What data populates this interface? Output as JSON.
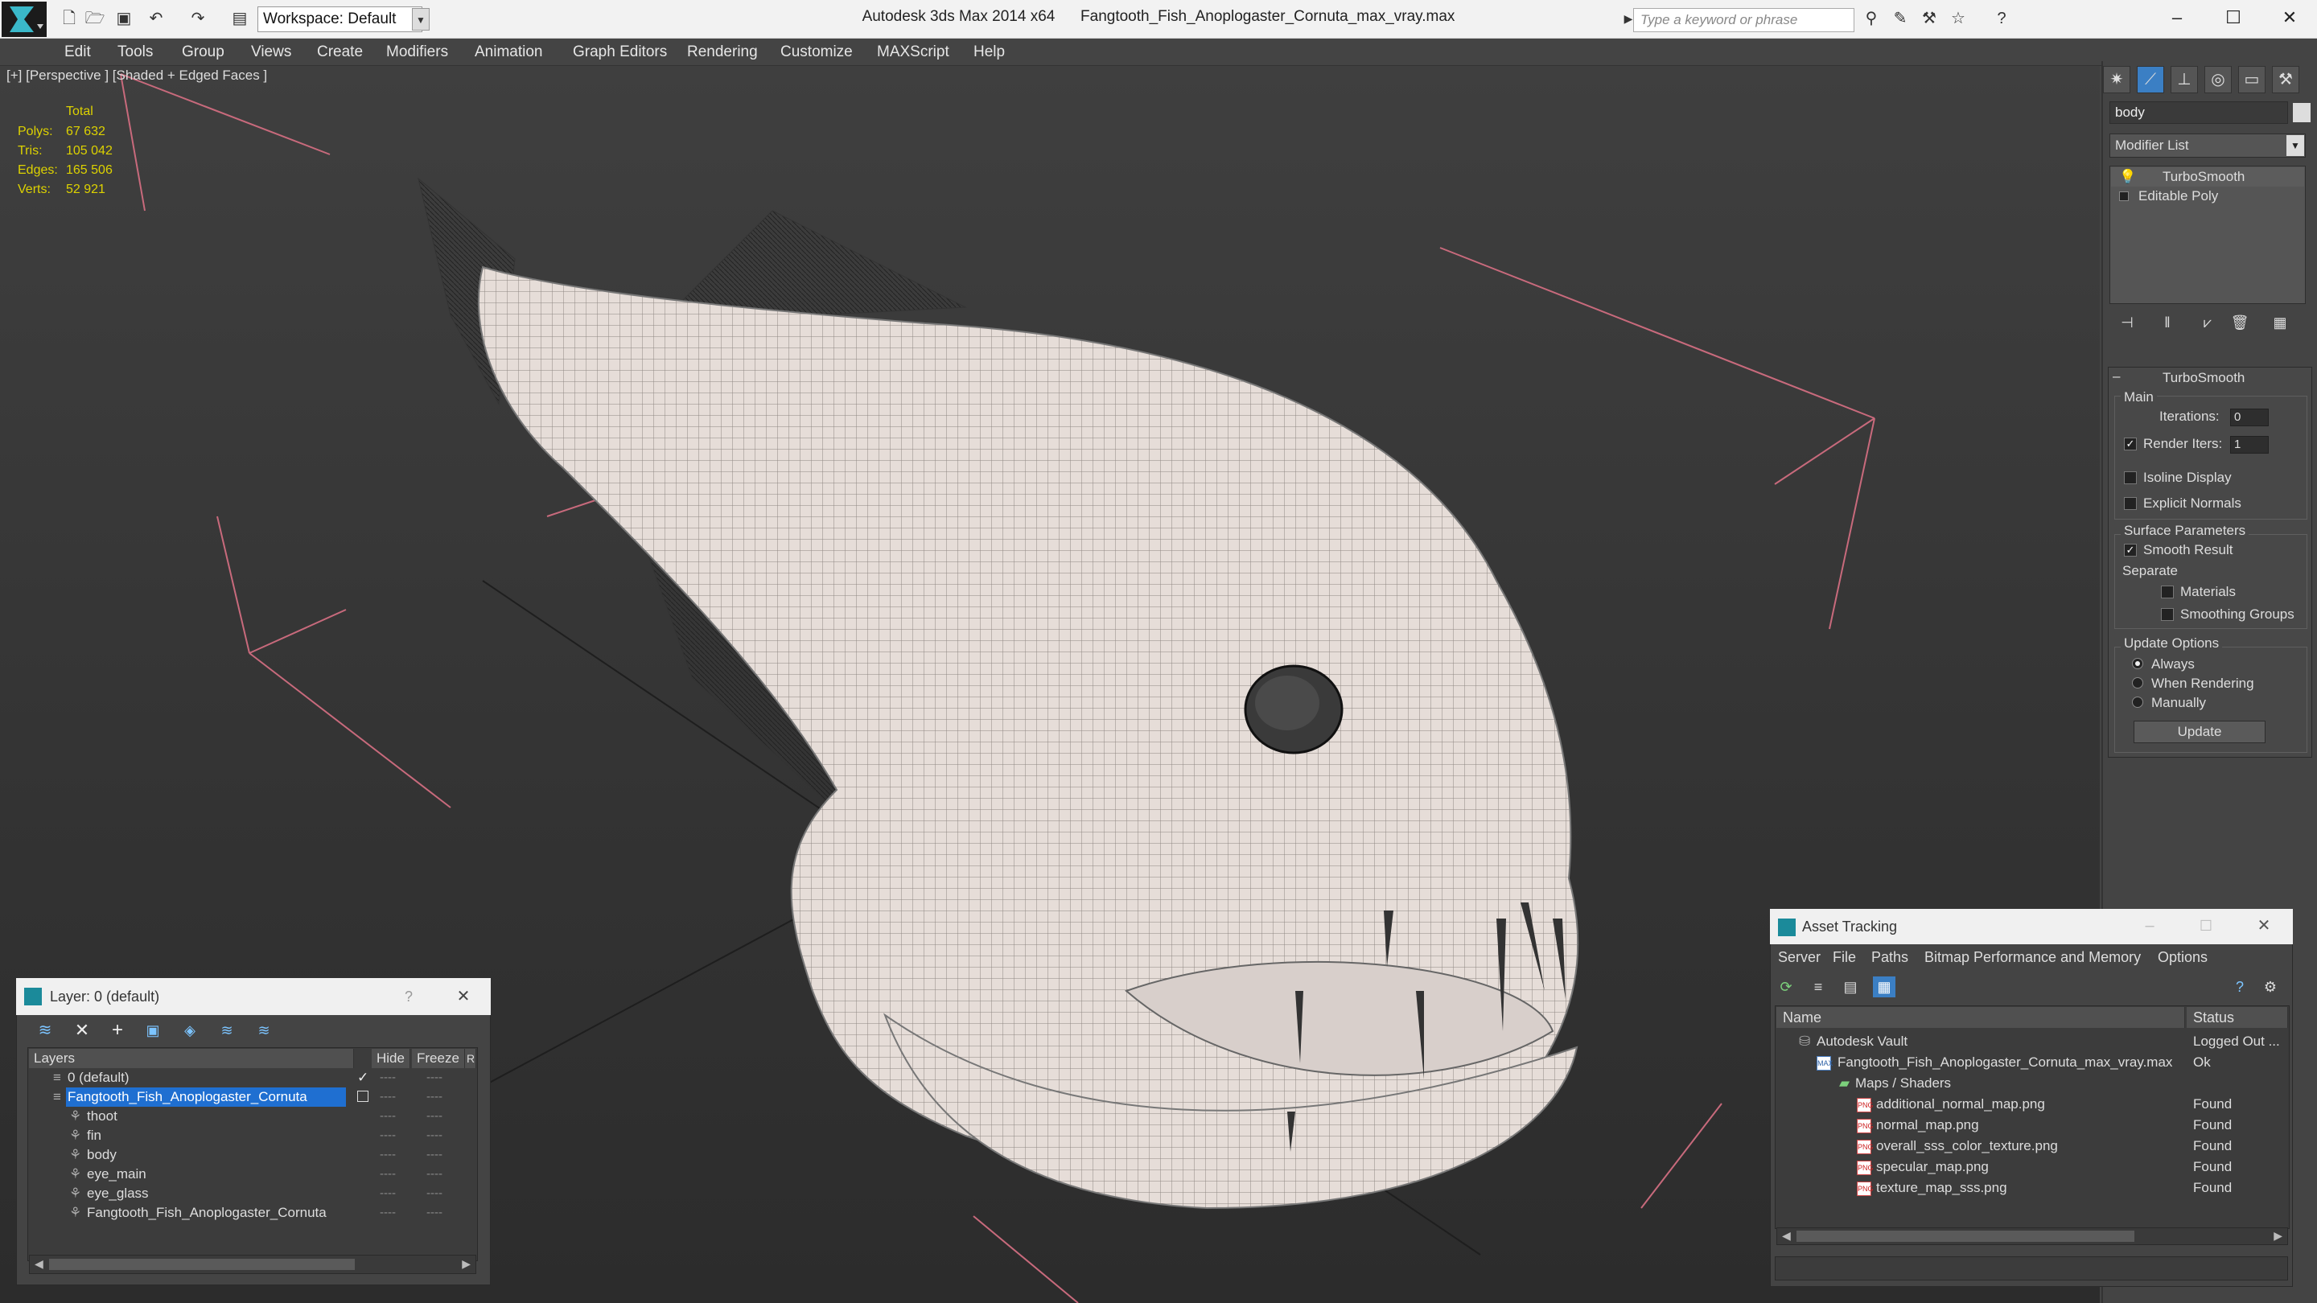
{
  "titlebar": {
    "app_name": "Autodesk 3ds Max  2014 x64",
    "file_name": "Fangtooth_Fish_Anoplogaster_Cornuta_max_vray.max",
    "workspace": "Workspace: Default",
    "search_placeholder": "Type a keyword or phrase"
  },
  "menu": [
    "Edit",
    "Tools",
    "Group",
    "Views",
    "Create",
    "Modifiers",
    "Animation",
    "Graph Editors",
    "Rendering",
    "Customize",
    "MAXScript",
    "Help"
  ],
  "viewport": {
    "label": "[+] [Perspective ] [Shaded + Edged Faces ]",
    "stats": {
      "header": "Total",
      "polys_label": "Polys:",
      "polys": "67 632",
      "tris_label": "Tris:",
      "tris": "105 042",
      "edges_label": "Edges:",
      "edges": "165 506",
      "verts_label": "Verts:",
      "verts": "52 921"
    }
  },
  "command_panel": {
    "object_name": "body",
    "modifier_list": "Modifier List",
    "stack": [
      "TurboSmooth",
      "Editable Poly"
    ],
    "rollout_title": "TurboSmooth",
    "main_label": "Main",
    "iterations_label": "Iterations:",
    "iterations": "0",
    "render_iters_label": "Render Iters:",
    "render_iters": "1",
    "isoline_label": "Isoline Display",
    "explicit_normals_label": "Explicit Normals",
    "surface_params_label": "Surface Parameters",
    "smooth_result_label": "Smooth Result",
    "separate_label": "Separate",
    "materials_label": "Materials",
    "smoothing_groups_label": "Smoothing Groups",
    "update_options_label": "Update Options",
    "always_label": "Always",
    "when_rendering_label": "When Rendering",
    "manually_label": "Manually",
    "update_button": "Update"
  },
  "layer_dialog": {
    "title": "Layer: 0 (default)",
    "headers": {
      "layers": "Layers",
      "hide": "Hide",
      "freeze": "Freeze",
      "r": "R"
    },
    "rows": [
      {
        "name": "0 (default)"
      },
      {
        "name": "Fangtooth_Fish_Anoplogaster_Cornuta"
      },
      {
        "name": "thoot"
      },
      {
        "name": "fin"
      },
      {
        "name": "body"
      },
      {
        "name": "eye_main"
      },
      {
        "name": "eye_glass"
      },
      {
        "name": "Fangtooth_Fish_Anoplogaster_Cornuta"
      }
    ],
    "dash": "----"
  },
  "asset_tracking": {
    "title": "Asset Tracking",
    "menu": [
      "Server",
      "File",
      "Paths",
      "Bitmap Performance and Memory",
      "Options"
    ],
    "headers": {
      "name": "Name",
      "status": "Status"
    },
    "rows": [
      {
        "name": "Autodesk Vault",
        "status": "Logged Out ..."
      },
      {
        "name": "Fangtooth_Fish_Anoplogaster_Cornuta_max_vray.max",
        "status": "Ok"
      },
      {
        "name": "Maps / Shaders",
        "status": ""
      },
      {
        "name": "additional_normal_map.png",
        "status": "Found"
      },
      {
        "name": "normal_map.png",
        "status": "Found"
      },
      {
        "name": "overall_sss_color_texture.png",
        "status": "Found"
      },
      {
        "name": "specular_map.png",
        "status": "Found"
      },
      {
        "name": "texture_map_sss.png",
        "status": "Found"
      }
    ],
    "png_tag": "PNG",
    "max_tag": "MAX"
  }
}
